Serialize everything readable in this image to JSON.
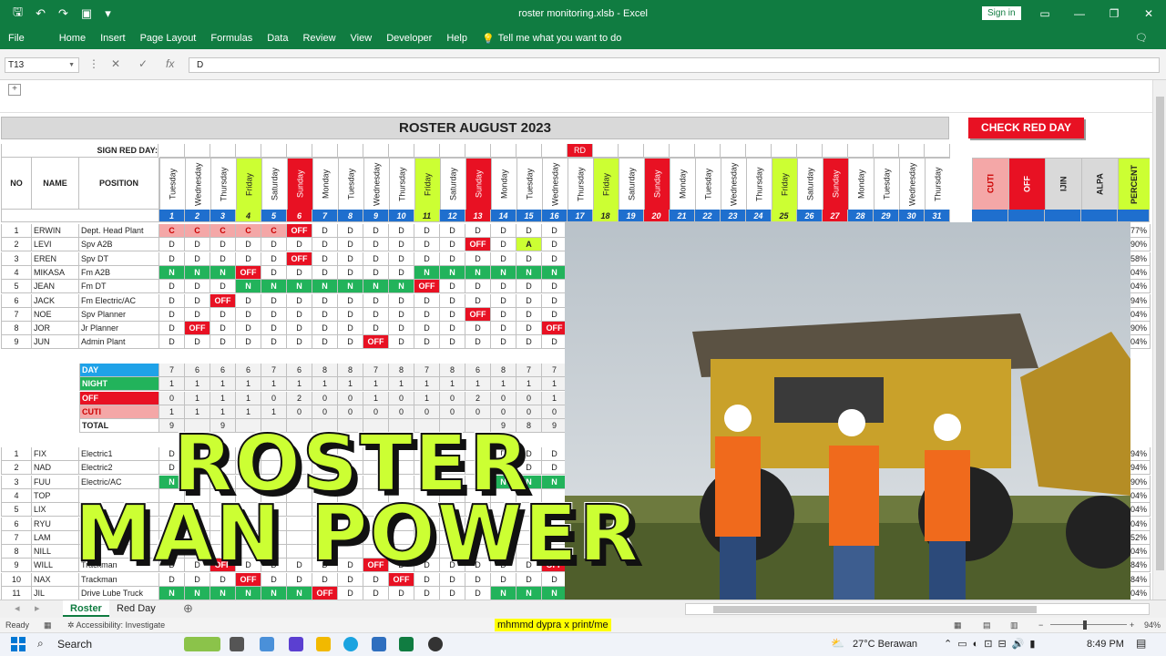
{
  "window": {
    "title": "roster monitoring.xlsb  -  Excel",
    "sign_in": "Sign in"
  },
  "ribbon": {
    "tabs": [
      "File",
      "Home",
      "Insert",
      "Page Layout",
      "Formulas",
      "Data",
      "Review",
      "View",
      "Developer",
      "Help"
    ],
    "tell_me": "Tell me what you want to do"
  },
  "formula_bar": {
    "name_box": "T13",
    "value": "D"
  },
  "sheet": {
    "title": "ROSTER AUGUST 2023",
    "check_button": "CHECK RED DAY",
    "sign_red_day_label": "SIGN RED DAY:",
    "rd_marker": "RD",
    "headers": {
      "no": "NO",
      "name": "NAME",
      "position": "POSITION"
    },
    "days": [
      "Tuesday",
      "Wednesday",
      "Thursday",
      "Friday",
      "Saturday",
      "Sunday",
      "Monday",
      "Tuesday",
      "Wednesday",
      "Thursday",
      "Friday",
      "Saturday",
      "Sunday",
      "Monday",
      "Tuesday",
      "Wednesday",
      "Thursday",
      "Friday",
      "Saturday",
      "Sunday",
      "Monday",
      "Tuesday",
      "Wednesday",
      "Thursday",
      "Friday",
      "Saturday",
      "Sunday",
      "Monday",
      "Tuesday",
      "Wednesday",
      "Thursday"
    ],
    "dates": [
      "1",
      "2",
      "3",
      "4",
      "5",
      "6",
      "7",
      "8",
      "9",
      "10",
      "11",
      "12",
      "13",
      "14",
      "15",
      "16",
      "17",
      "18",
      "19",
      "20",
      "21",
      "22",
      "23",
      "24",
      "25",
      "26",
      "27",
      "28",
      "29",
      "30",
      "31"
    ],
    "summary_headers": [
      "CUTI",
      "OFF",
      "IJIN",
      "ALPA",
      "PERCENT"
    ],
    "colors": {
      "friday": "#ccff33",
      "sunday": "#e81123",
      "date_row": "#1f6fce",
      "day_row": "#1fa2e8",
      "night": "#22b35b",
      "off": "#e81123",
      "cuti": "#f4a7a7"
    },
    "employees": [
      {
        "no": "1",
        "name": "ERWIN",
        "position": "Dept. Head Plant",
        "shifts": [
          "C",
          "C",
          "C",
          "C",
          "C",
          "OFF",
          "D",
          "D",
          "D",
          "D",
          "D",
          "D",
          "D",
          "D",
          "D",
          "D"
        ],
        "percent": "77%"
      },
      {
        "no": "2",
        "name": "LEVI",
        "position": "Spv A2B",
        "shifts": [
          "D",
          "D",
          "D",
          "D",
          "D",
          "D",
          "D",
          "D",
          "D",
          "D",
          "D",
          "D",
          "OFF",
          "D",
          "A",
          "D"
        ],
        "percent": "90%"
      },
      {
        "no": "3",
        "name": "EREN",
        "position": "Spv DT",
        "shifts": [
          "D",
          "D",
          "D",
          "D",
          "D",
          "OFF",
          "D",
          "D",
          "D",
          "D",
          "D",
          "D",
          "D",
          "D",
          "D",
          "D"
        ],
        "percent": "58%"
      },
      {
        "no": "4",
        "name": "MIKASA",
        "position": "Fm A2B",
        "shifts": [
          "N",
          "N",
          "N",
          "OFF",
          "D",
          "D",
          "D",
          "D",
          "D",
          "D",
          "N",
          "N",
          "N",
          "N",
          "N",
          "N"
        ],
        "percent": "04%"
      },
      {
        "no": "5",
        "name": "JEAN",
        "position": "Fm DT",
        "shifts": [
          "D",
          "D",
          "D",
          "N",
          "N",
          "N",
          "N",
          "N",
          "N",
          "N",
          "OFF",
          "D",
          "D",
          "D",
          "D",
          "D"
        ],
        "percent": "04%"
      },
      {
        "no": "6",
        "name": "JACK",
        "position": "Fm Electric/AC",
        "shifts": [
          "D",
          "D",
          "OFF",
          "D",
          "D",
          "D",
          "D",
          "D",
          "D",
          "D",
          "D",
          "D",
          "D",
          "D",
          "D",
          "D"
        ],
        "percent": "94%"
      },
      {
        "no": "7",
        "name": "NOE",
        "position": "Spv Planner",
        "shifts": [
          "D",
          "D",
          "D",
          "D",
          "D",
          "D",
          "D",
          "D",
          "D",
          "D",
          "D",
          "D",
          "OFF",
          "D",
          "D",
          "D"
        ],
        "percent": "04%"
      },
      {
        "no": "8",
        "name": "JOR",
        "position": "Jr Planner",
        "shifts": [
          "D",
          "OFF",
          "D",
          "D",
          "D",
          "D",
          "D",
          "D",
          "D",
          "D",
          "D",
          "D",
          "D",
          "D",
          "D",
          "OFF"
        ],
        "percent": "90%"
      },
      {
        "no": "9",
        "name": "JUN",
        "position": "Admin Plant",
        "shifts": [
          "D",
          "D",
          "D",
          "D",
          "D",
          "D",
          "D",
          "D",
          "OFF",
          "D",
          "D",
          "D",
          "D",
          "D",
          "D",
          "D"
        ],
        "percent": "04%"
      }
    ],
    "summary_rows": [
      {
        "label": "DAY",
        "values": [
          "7",
          "6",
          "6",
          "6",
          "7",
          "6",
          "8",
          "8",
          "7",
          "8",
          "7",
          "8",
          "6",
          "8",
          "7",
          "7"
        ]
      },
      {
        "label": "NIGHT",
        "values": [
          "1",
          "1",
          "1",
          "1",
          "1",
          "1",
          "1",
          "1",
          "1",
          "1",
          "1",
          "1",
          "1",
          "1",
          "1",
          "1"
        ]
      },
      {
        "label": "OFF",
        "values": [
          "0",
          "1",
          "1",
          "1",
          "0",
          "2",
          "0",
          "0",
          "1",
          "0",
          "1",
          "0",
          "2",
          "0",
          "0",
          "1"
        ]
      },
      {
        "label": "CUTI",
        "values": [
          "1",
          "1",
          "1",
          "1",
          "1",
          "0",
          "0",
          "0",
          "0",
          "0",
          "0",
          "0",
          "0",
          "0",
          "0",
          "0"
        ]
      },
      {
        "label": "TOTAL",
        "values": [
          "9",
          "",
          "9",
          "",
          "",
          "",
          "",
          "",
          "",
          "",
          "",
          "",
          "",
          "9",
          "8",
          "9"
        ]
      }
    ],
    "employees2": [
      {
        "no": "1",
        "name": "FIX",
        "position": "Electric1",
        "shifts": [
          "D",
          "",
          "",
          "",
          "",
          "",
          "",
          "",
          "",
          "",
          "",
          "",
          "",
          "D",
          "D",
          "D"
        ],
        "percent": "94%"
      },
      {
        "no": "2",
        "name": "NAD",
        "position": "Electric2",
        "shifts": [
          "D",
          "",
          "",
          "",
          "",
          "",
          "",
          "",
          "",
          "",
          "",
          "",
          "",
          "D",
          "D",
          "D"
        ],
        "percent": "94%"
      },
      {
        "no": "3",
        "name": "FUU",
        "position": "Electric/AC",
        "shifts": [
          "N",
          "",
          "",
          "",
          "",
          "",
          "",
          "",
          "",
          "",
          "",
          "",
          "",
          "N",
          "N",
          "N"
        ],
        "percent": "90%"
      },
      {
        "no": "4",
        "name": "TOP",
        "position": "",
        "shifts": [
          "",
          "",
          "",
          "",
          "",
          "",
          "",
          "",
          "",
          "",
          "",
          "",
          "",
          "",
          "",
          ""
        ],
        "percent": "04%"
      },
      {
        "no": "5",
        "name": "LIX",
        "position": "",
        "shifts": [
          "",
          "",
          "",
          "",
          "",
          "",
          "",
          "",
          "",
          "",
          "",
          "",
          "",
          "",
          "",
          ""
        ],
        "percent": "04%"
      },
      {
        "no": "6",
        "name": "RYU",
        "position": "",
        "shifts": [
          "",
          "",
          "",
          "",
          "",
          "",
          "",
          "",
          "",
          "",
          "",
          "",
          "",
          "",
          "",
          ""
        ],
        "percent": "04%"
      },
      {
        "no": "7",
        "name": "LAM",
        "position": "",
        "shifts": [
          "",
          "",
          "",
          "",
          "",
          "",
          "",
          "",
          "",
          "",
          "",
          "",
          "",
          "",
          "",
          ""
        ],
        "percent": "52%"
      },
      {
        "no": "8",
        "name": "NILL",
        "position": "",
        "shifts": [
          "",
          "",
          "",
          "",
          "",
          "",
          "",
          "",
          "",
          "",
          "",
          "",
          "",
          "",
          "",
          ""
        ],
        "percent": "04%"
      },
      {
        "no": "9",
        "name": "WILL",
        "position": "Trackman",
        "shifts": [
          "D",
          "D",
          "OFF",
          "D",
          "D",
          "D",
          "D",
          "D",
          "OFF",
          "D",
          "D",
          "D",
          "D",
          "D",
          "D",
          "OFF"
        ],
        "percent": "84%"
      },
      {
        "no": "10",
        "name": "NAX",
        "position": "Trackman",
        "shifts": [
          "D",
          "D",
          "D",
          "OFF",
          "D",
          "D",
          "D",
          "D",
          "D",
          "OFF",
          "D",
          "D",
          "D",
          "D",
          "D",
          "D"
        ],
        "percent": "84%"
      },
      {
        "no": "11",
        "name": "JIL",
        "position": "Drive Lube Truck",
        "shifts": [
          "N",
          "N",
          "N",
          "N",
          "N",
          "N",
          "OFF",
          "D",
          "D",
          "D",
          "D",
          "D",
          "D",
          "N",
          "N",
          "N"
        ],
        "percent": "04%"
      }
    ]
  },
  "overlay": {
    "line1": "ROSTER",
    "line2": "MAN POWER"
  },
  "sheet_tabs": [
    "Roster",
    "Red Day"
  ],
  "status": {
    "ready": "Ready",
    "accessibility": "Accessibility: Investigate",
    "credit": "mhmmd dypra x print/me",
    "zoom": "94%"
  },
  "taskbar": {
    "search": "Search",
    "weather": "27°C  Berawan",
    "time": "8:49 PM"
  }
}
